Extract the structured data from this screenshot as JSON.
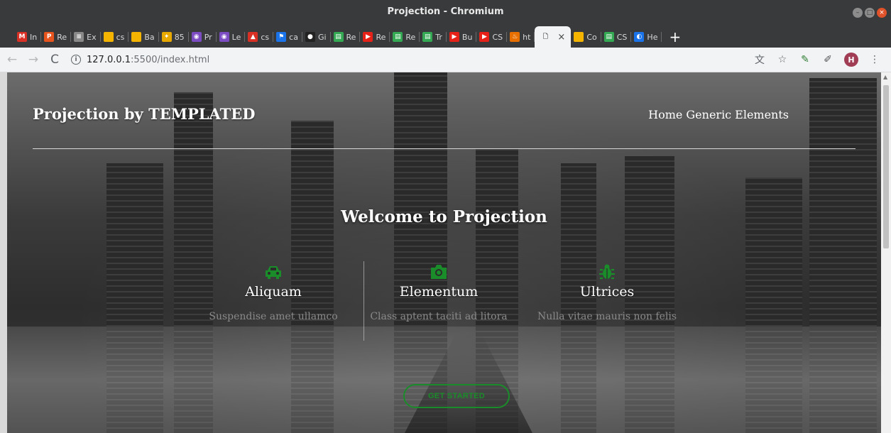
{
  "window": {
    "title": "Projection - Chromium"
  },
  "tabs": [
    {
      "label": "In",
      "icon": "gmail-icon",
      "color": "#d93025",
      "glyph": "M"
    },
    {
      "label": "Re",
      "icon": "pinterest-icon",
      "color": "#e8541e",
      "glyph": "P"
    },
    {
      "label": "Ex",
      "icon": "list-icon",
      "color": "#888888",
      "glyph": "≡"
    },
    {
      "label": "cs",
      "icon": "slides-icon",
      "color": "#f4b400",
      "glyph": ""
    },
    {
      "label": "Ba",
      "icon": "slides-icon",
      "color": "#f4b400",
      "glyph": ""
    },
    {
      "label": "85",
      "icon": "star-icon",
      "color": "#e8a800",
      "glyph": "✦"
    },
    {
      "label": "Pr",
      "icon": "colorwheel-icon",
      "color": "#7b4cc2",
      "glyph": "◉"
    },
    {
      "label": "Le",
      "icon": "colorwheel-icon",
      "color": "#7b4cc2",
      "glyph": "◉"
    },
    {
      "label": "cs",
      "icon": "mountain-icon",
      "color": "#d93025",
      "glyph": "▲"
    },
    {
      "label": "ca",
      "icon": "flag-icon",
      "color": "#1a73e8",
      "glyph": "⚑"
    },
    {
      "label": "Gi",
      "icon": "github-icon",
      "color": "#222222",
      "glyph": "●"
    },
    {
      "label": "Re",
      "icon": "chart-icon",
      "color": "#34a853",
      "glyph": "▤"
    },
    {
      "label": "Re",
      "icon": "youtube-icon",
      "color": "#e62117",
      "glyph": "▶"
    },
    {
      "label": "Re",
      "icon": "chart-icon",
      "color": "#34a853",
      "glyph": "▤"
    },
    {
      "label": "Tr",
      "icon": "chart-icon",
      "color": "#34a853",
      "glyph": "▤"
    },
    {
      "label": "Bu",
      "icon": "youtube-icon",
      "color": "#e62117",
      "glyph": "▶"
    },
    {
      "label": "CS",
      "icon": "youtube-icon",
      "color": "#e62117",
      "glyph": "▶"
    },
    {
      "label": "ht",
      "icon": "java-icon",
      "color": "#e76f00",
      "glyph": "♨"
    },
    {
      "label": "",
      "icon": "page-icon",
      "color": "#f1f3f4",
      "glyph": "🗋",
      "active": true
    },
    {
      "label": "Co",
      "icon": "slides-icon",
      "color": "#f4b400",
      "glyph": ""
    },
    {
      "label": "CS",
      "icon": "chart-icon",
      "color": "#34a853",
      "glyph": "▤"
    },
    {
      "label": "He",
      "icon": "colorwheel-icon",
      "color": "#1a73e8",
      "glyph": "◐"
    }
  ],
  "toolbar": {
    "url_host": "127.0.0.1",
    "url_path": ":5500/index.html",
    "avatar_letter": "H"
  },
  "site": {
    "title": "Projection by TEMPLATED",
    "nav": [
      "Home",
      "Generic",
      "Elements"
    ],
    "hero_title": "Welcome to Projection",
    "features": [
      {
        "name": "Aliquam",
        "desc": "Suspendise amet ullamco",
        "icon": "car-icon"
      },
      {
        "name": "Elementum",
        "desc": "Class aptent taciti ad litora",
        "icon": "camera-icon"
      },
      {
        "name": "Ultrices",
        "desc": "Nulla vitae mauris non felis",
        "icon": "bug-icon"
      }
    ],
    "cta_label": "GET STARTED",
    "accent_color": "#1a8c2a"
  }
}
